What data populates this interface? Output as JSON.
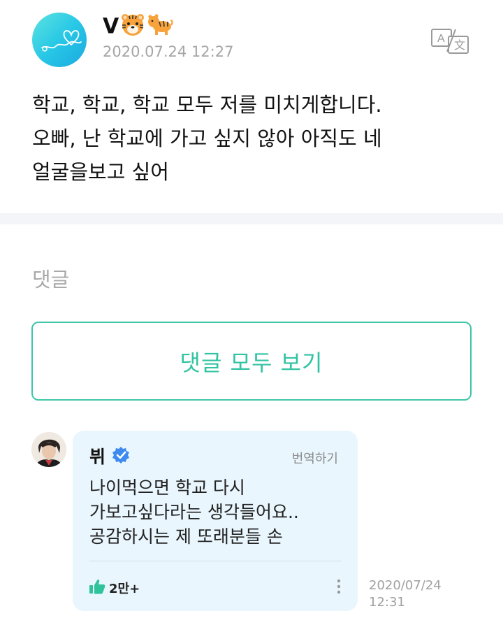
{
  "post": {
    "author_name": "V",
    "author_emojis": [
      "tiger-face-icon",
      "tiger-icon"
    ],
    "timestamp": "2020.07.24 12:27",
    "translate_icon": "translate-icon",
    "body_lines": [
      "학교, 학교, 학교 모두 저를 미치게합니다.",
      "오빠, 난 학교에 가고 싶지 않아 아직도 네",
      "얼굴을보고 싶어"
    ]
  },
  "comments": {
    "section_label": "댓글",
    "view_all_label": "댓글 모두 보기"
  },
  "comment": {
    "author": "뷔",
    "verified_icon": "verified-check-icon",
    "translate_label": "번역하기",
    "text_lines": [
      "나이먹으면 학교 다시",
      "가보고싶다라는 생각들어요..",
      "공감하시는 제 또래분들 손"
    ],
    "like_icon": "thumbs-up-icon",
    "like_count": "2만+",
    "more_icon": "more-vertical-icon",
    "date": "2020/07/24",
    "time": "12:31"
  },
  "colors": {
    "accent": "#32c3a3",
    "comment_bg": "#e9f6fd",
    "verified": "#3d8af0",
    "timestamp": "#a6a6a6"
  }
}
